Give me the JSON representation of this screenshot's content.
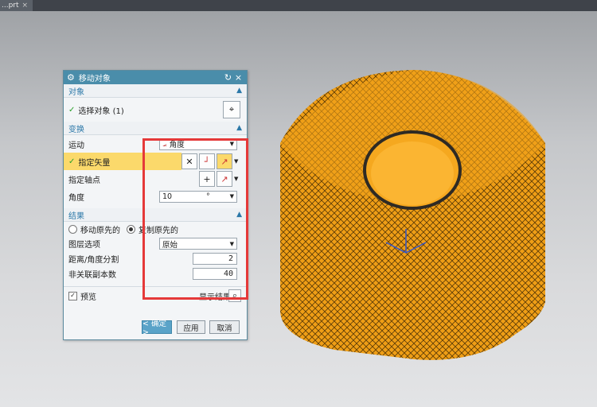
{
  "tab": {
    "filename": "...prt",
    "close": "×"
  },
  "dialog": {
    "title": "移动对象",
    "reset_icon": "↻",
    "close_icon": "×",
    "sections": {
      "object": {
        "label": "对象",
        "select_label": "选择对象 (1)"
      },
      "transform": {
        "label": "变换",
        "motion_label": "运动",
        "motion_value": "角度",
        "vector_label": "指定矢量",
        "pivot_label": "指定轴点",
        "angle_label": "角度",
        "angle_value": "10",
        "angle_unit": "°"
      },
      "result": {
        "label": "结果",
        "move_original": "移动原先的",
        "copy_original": "复制原先的",
        "layer_label": "图层选项",
        "layer_value": "原始",
        "distance_label": "距离/角度分割",
        "distance_value": "2",
        "copies_label": "非关联副本数",
        "copies_value": "40"
      }
    },
    "preview_label": "预览",
    "show_result_label": "显示结果",
    "buttons": {
      "ok": "< 确定 >",
      "apply": "应用",
      "cancel": "取消"
    }
  },
  "colors": {
    "accent": "#4a8daa",
    "highlight": "#fbd96b",
    "callout": "#e53939",
    "model": "#f0a21a"
  }
}
